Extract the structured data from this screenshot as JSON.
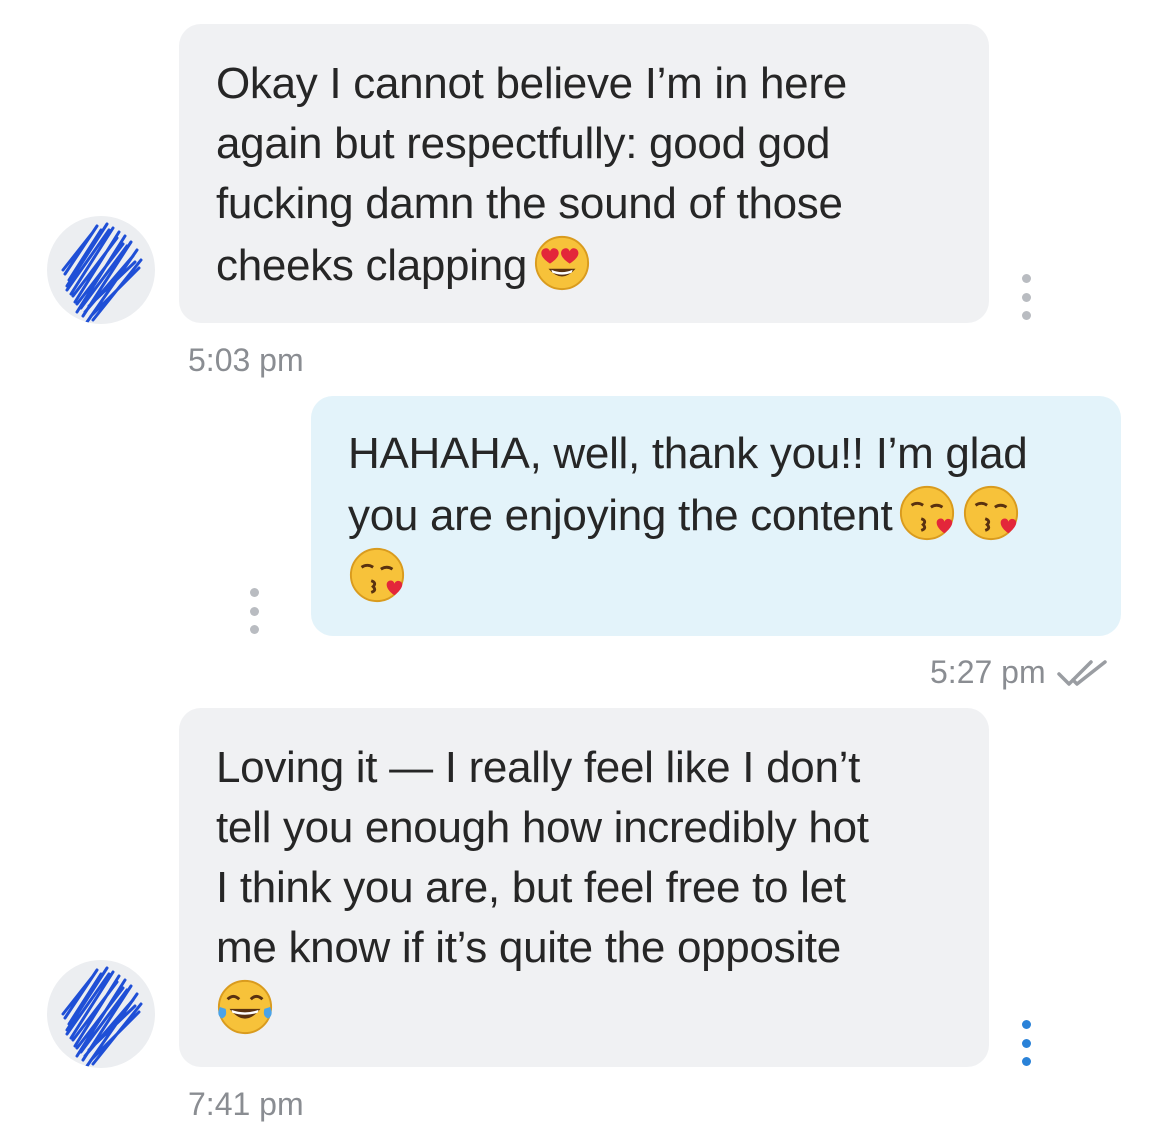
{
  "messages": [
    {
      "direction": "incoming",
      "text": "Okay I cannot believe I’m in here\nagain but respectfully: good god\nfucking damn the sound of those\ncheeks clapping",
      "emoji": [
        "heart-eyes-face"
      ],
      "time": "5:03 pm"
    },
    {
      "direction": "outgoing",
      "text": "HAHAHA, well, thank you!! I’m glad\nyou are enjoying the content",
      "emoji": [
        "kissing-heart-face",
        "kissing-heart-face",
        "kissing-heart-face"
      ],
      "time": "5:27 pm",
      "status": "read"
    },
    {
      "direction": "incoming",
      "text": "Loving it — I really feel like I don’t\ntell you enough how incredibly hot\nI think you are, but feel free to let\nme know if it’s quite the opposite",
      "emoji": [
        "tears-of-joy-face"
      ],
      "time": "7:41 pm"
    }
  ],
  "colors": {
    "incoming_bubble": "#f0f1f3",
    "outgoing_bubble": "#e3f3fa",
    "timestamp": "#8a8d92",
    "more_dots_blue": "#2a82d8",
    "avatar_scribble": "#1f4fd6"
  }
}
